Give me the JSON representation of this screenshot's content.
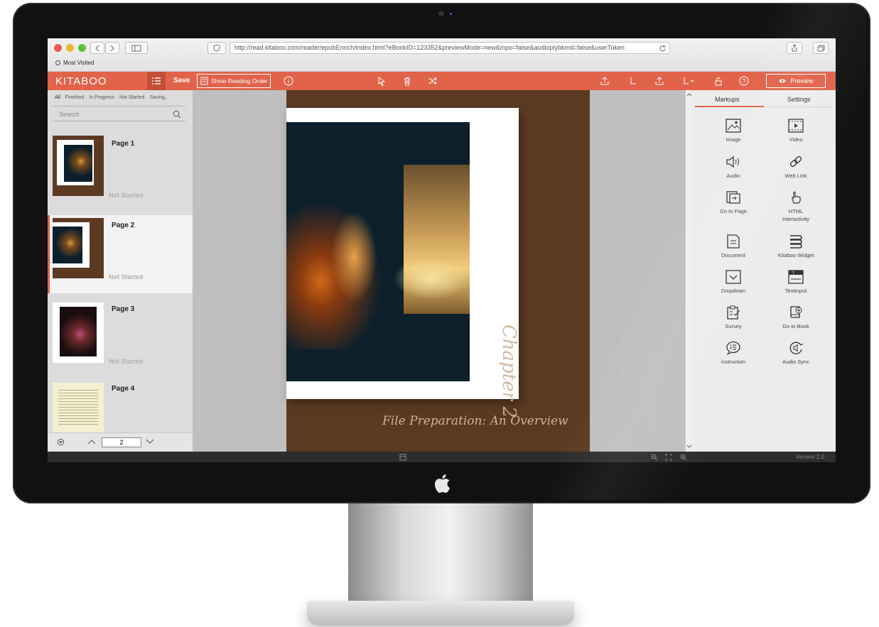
{
  "browser": {
    "url": "http://read.kitaboo.com/reader/epubEnrich/index.html?eBookID=123352&previewMode=new&mpo=false&audioplybkmd=false&userToken",
    "bookmarks_label": "Most Visited"
  },
  "toolbar": {
    "logo": "KITABOO",
    "save_label": "Save",
    "show_reading_order_label": "Show Reading Order",
    "preview_label": "Preview"
  },
  "left_panel": {
    "filters": [
      "All",
      "Finished",
      "In Progress",
      "Not Started",
      "Saving..."
    ],
    "search_placeholder": "Search",
    "pages": [
      {
        "label": "Page 1",
        "status": "Not Started"
      },
      {
        "label": "Page 2",
        "status": "Not Started"
      },
      {
        "label": "Page 3",
        "status": "Not Started"
      },
      {
        "label": "Page 4",
        "status": ""
      }
    ],
    "current_page": "2"
  },
  "book_page": {
    "chapter": "Chapter 2",
    "title": "File Preparation: An Overview"
  },
  "right_panel": {
    "tabs": [
      "Markups",
      "Settings"
    ],
    "markups": [
      {
        "label": "Image",
        "icon": "image-icon"
      },
      {
        "label": "Video",
        "icon": "video-icon"
      },
      {
        "label": "Audio",
        "icon": "audio-icon"
      },
      {
        "label": "Web Link",
        "icon": "link-icon"
      },
      {
        "label": "Go to Page",
        "icon": "go-to-page-icon"
      },
      {
        "label": "HTML Interactivity",
        "icon": "pointer-hand-icon"
      },
      {
        "label": "Document",
        "icon": "document-icon"
      },
      {
        "label": "Kitaboo Widget",
        "icon": "widget-icon"
      },
      {
        "label": "Dropdown",
        "icon": "dropdown-icon"
      },
      {
        "label": "TextInput",
        "icon": "text-input-icon"
      },
      {
        "label": "Survey",
        "icon": "survey-icon"
      },
      {
        "label": "Go to Book",
        "icon": "book-icon"
      },
      {
        "label": "instruction",
        "icon": "instruction-icon"
      },
      {
        "label": "Audio Sync",
        "icon": "audio-sync-icon"
      }
    ]
  },
  "status_bar": {
    "version": "Version 2.0"
  },
  "colors": {
    "accent": "#e0634a",
    "book_cover": "#5c3a22"
  }
}
